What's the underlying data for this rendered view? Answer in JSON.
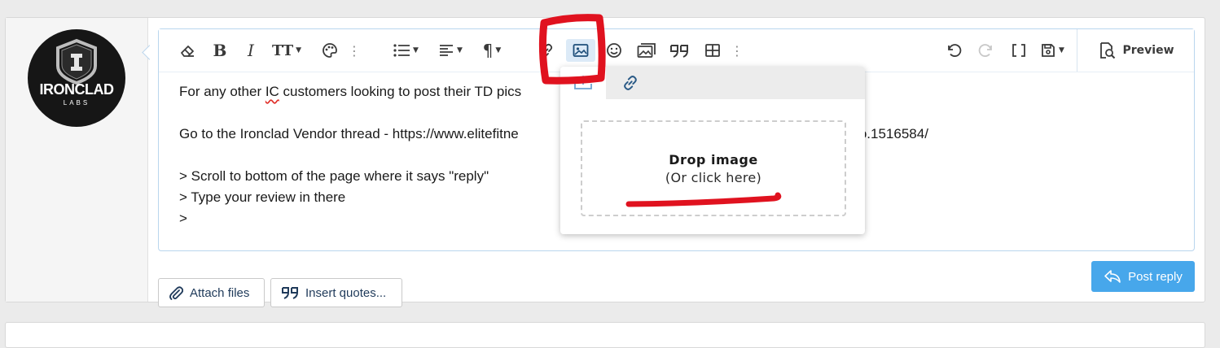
{
  "avatar": {
    "brand": "IRONCLAD",
    "sub": "LABS"
  },
  "toolbar": {
    "icons": [
      "eraser-icon",
      "bold-icon",
      "italic-icon",
      "text-size-icon",
      "palette-icon",
      "more-icon",
      "list-icon",
      "align-icon",
      "paragraph-icon",
      "link-icon",
      "image-icon",
      "emoji-icon",
      "media-icon",
      "quote-icon",
      "table-icon",
      "more-icon",
      "undo-icon",
      "redo-icon",
      "brackets-icon",
      "save-draft-icon"
    ],
    "bold_label": "B",
    "italic_label": "I",
    "text_size_label": "TT",
    "paragraph_label": "¶",
    "preview_label": "Preview"
  },
  "editor": {
    "lines": [
      {
        "pre": "For any other ",
        "err": "IC",
        "post": " customers looking to post their TD pics "
      },
      {
        "text": ""
      },
      {
        "text": "Go to the Ironclad Vendor thread - https://www.elitefitne",
        "tail": "ntro.1516584/"
      },
      {
        "text": ""
      },
      {
        "text": "> Scroll to bottom of the page where it says \"reply\""
      },
      {
        "text": "> Type your review in there"
      },
      {
        "text": ">"
      }
    ]
  },
  "image_popup": {
    "tabs": [
      "upload-icon",
      "link-icon"
    ],
    "drop_title": "Drop image",
    "drop_sub": "(Or click here)"
  },
  "footer": {
    "attach_label": "Attach files",
    "insert_quotes_label": "Insert quotes...",
    "post_reply_label": "Post reply"
  },
  "colors": {
    "primary": "#47a7eb",
    "annotation": "#e0121f",
    "editor_border": "#b9d6ee"
  }
}
